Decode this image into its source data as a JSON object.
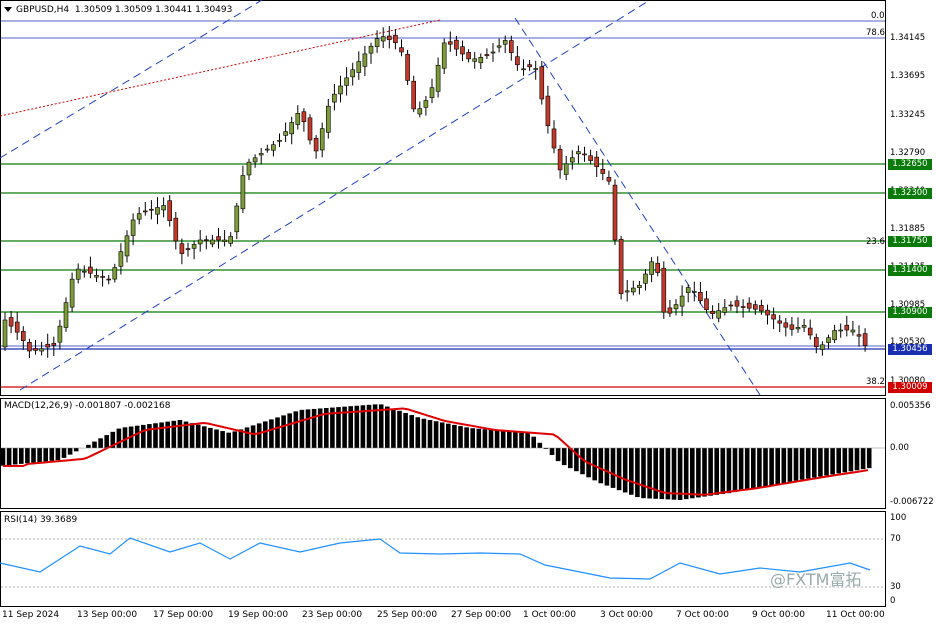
{
  "header": {
    "symbol": "GBPUSD,H4",
    "ohlc": "1.30509 1.30509 1.30441 1.30493"
  },
  "price_axis": {
    "ticks": [
      "1.34145",
      "1.33695",
      "1.33245",
      "1.32790",
      "1.32340",
      "1.31885",
      "1.31435",
      "1.30985",
      "1.30530",
      "1.30080"
    ],
    "levels": [
      {
        "value": "1.32650",
        "color": "#0a7a0a"
      },
      {
        "value": "1.32300",
        "color": "#0a7a0a"
      },
      {
        "value": "1.31750",
        "color": "#0a7a0a"
      },
      {
        "value": "1.31400",
        "color": "#0a7a0a"
      },
      {
        "value": "1.30900",
        "color": "#0a7a0a"
      },
      {
        "value": "1.30456",
        "color": "#1a2fb0"
      },
      {
        "value": "1.30009",
        "color": "#d00000"
      }
    ]
  },
  "fibonacci": {
    "labels": [
      "0.0",
      "78.6",
      "23.6",
      "38.2"
    ]
  },
  "macd": {
    "label": "MACD(12,26,9) -0.001807 -0.002168",
    "ticks": [
      "0.005356",
      "0.00",
      "-0.006722"
    ]
  },
  "rsi": {
    "label": "RSI(14) 39.3689",
    "ticks": [
      "100",
      "70",
      "30",
      "0"
    ]
  },
  "dates": [
    "11 Sep 2024",
    "13 Sep 00:00",
    "17 Sep 00:00",
    "19 Sep 00:00",
    "23 Sep 00:00",
    "25 Sep 00:00",
    "27 Sep 00:00",
    "1 Oct 00:00",
    "3 Oct 00:00",
    "7 Oct 00:00",
    "9 Oct 00:00",
    "11 Oct 00:00"
  ],
  "watermark": "@FXTM富拓",
  "colors": {
    "bull": "#7c9c3a",
    "bear": "#c0392b",
    "macd_signal": "#e00000",
    "rsi": "#1e90ff"
  }
}
